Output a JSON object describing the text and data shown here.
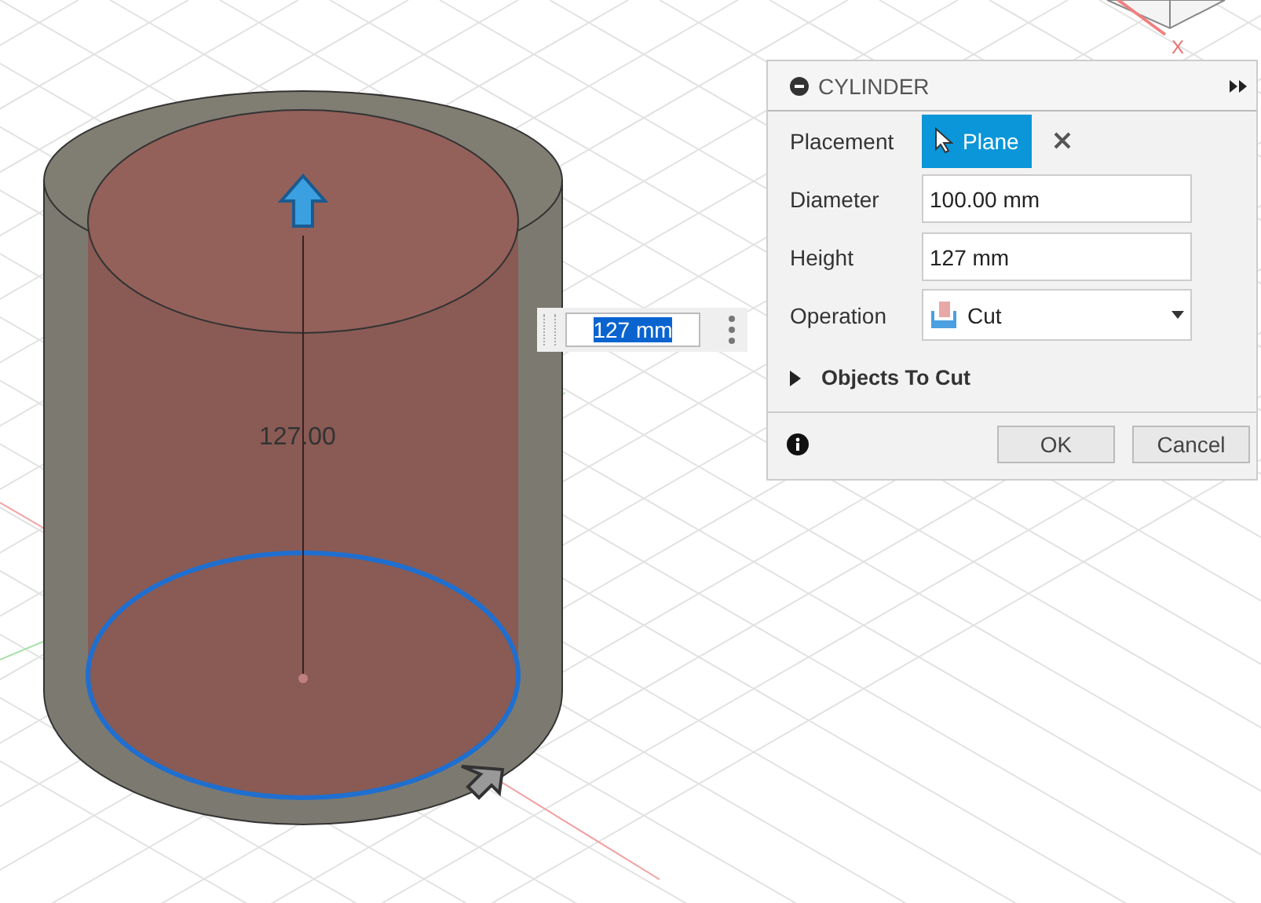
{
  "viewcube": {
    "axis_label": "X"
  },
  "dimension": {
    "label": "127.00"
  },
  "inline_input": {
    "value": "127 mm",
    "selected": true
  },
  "panel": {
    "title": "CYLINDER",
    "rows": [
      {
        "kind": "select",
        "label": "Placement",
        "value": "Plane"
      },
      {
        "kind": "input",
        "label": "Diameter",
        "value": "100.00 mm"
      },
      {
        "kind": "input",
        "label": "Height",
        "value": "127 mm"
      },
      {
        "kind": "dropdown",
        "label": "Operation",
        "value": "Cut"
      }
    ],
    "section": {
      "label": "Objects To Cut",
      "expanded": false
    },
    "buttons": [
      "OK",
      "Cancel"
    ]
  }
}
